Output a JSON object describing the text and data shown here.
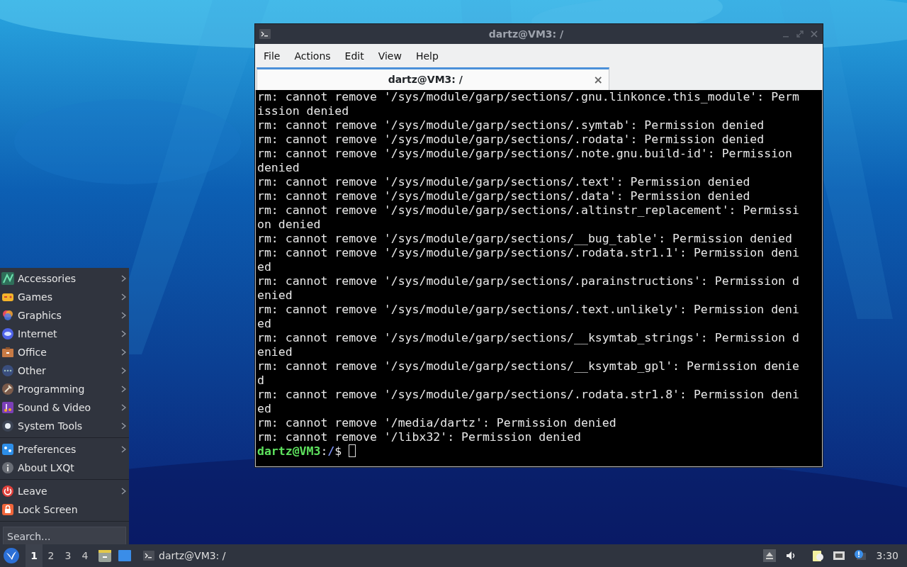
{
  "window": {
    "title": "dartz@VM3: /",
    "menu": [
      "File",
      "Actions",
      "Edit",
      "View",
      "Help"
    ],
    "tabs": [
      {
        "label": "dartz@VM3: /",
        "selected": true,
        "close": "×"
      }
    ],
    "terminal": {
      "lines": [
        "rm: cannot remove '/sys/module/garp/sections/.gnu.linkonce.this_module': Perm",
        "ission denied",
        "rm: cannot remove '/sys/module/garp/sections/.symtab': Permission denied",
        "rm: cannot remove '/sys/module/garp/sections/.rodata': Permission denied",
        "rm: cannot remove '/sys/module/garp/sections/.note.gnu.build-id': Permission",
        "denied",
        "rm: cannot remove '/sys/module/garp/sections/.text': Permission denied",
        "rm: cannot remove '/sys/module/garp/sections/.data': Permission denied",
        "rm: cannot remove '/sys/module/garp/sections/.altinstr_replacement': Permissi",
        "on denied",
        "rm: cannot remove '/sys/module/garp/sections/__bug_table': Permission denied",
        "rm: cannot remove '/sys/module/garp/sections/.rodata.str1.1': Permission deni",
        "ed",
        "rm: cannot remove '/sys/module/garp/sections/.parainstructions': Permission d",
        "enied",
        "rm: cannot remove '/sys/module/garp/sections/.text.unlikely': Permission deni",
        "ed",
        "rm: cannot remove '/sys/module/garp/sections/__ksymtab_strings': Permission d",
        "enied",
        "rm: cannot remove '/sys/module/garp/sections/__ksymtab_gpl': Permission denie",
        "d",
        "rm: cannot remove '/sys/module/garp/sections/.rodata.str1.8': Permission deni",
        "ed",
        "rm: cannot remove '/media/dartz': Permission denied",
        "rm: cannot remove '/libx32': Permission denied"
      ],
      "prompt": {
        "user_host": "dartz@VM3",
        "separator": ":",
        "path": "/",
        "symbol": "$"
      }
    }
  },
  "start_menu": {
    "sections": [
      [
        {
          "label": "Accessories",
          "submenu": true
        },
        {
          "label": "Games",
          "submenu": true
        },
        {
          "label": "Graphics",
          "submenu": true
        },
        {
          "label": "Internet",
          "submenu": true
        },
        {
          "label": "Office",
          "submenu": true
        },
        {
          "label": "Other",
          "submenu": true
        },
        {
          "label": "Programming",
          "submenu": true
        },
        {
          "label": "Sound & Video",
          "submenu": true
        },
        {
          "label": "System Tools",
          "submenu": true
        }
      ],
      [
        {
          "label": "Preferences",
          "submenu": true
        },
        {
          "label": "About LXQt",
          "submenu": false
        }
      ],
      [
        {
          "label": "Leave",
          "submenu": true
        },
        {
          "label": "Lock Screen",
          "submenu": false
        }
      ]
    ],
    "search": {
      "placeholder": "Search..."
    }
  },
  "taskbar": {
    "workspaces": [
      {
        "label": "1",
        "selected": true
      },
      {
        "label": "2",
        "selected": false
      },
      {
        "label": "3",
        "selected": false
      },
      {
        "label": "4",
        "selected": false
      }
    ],
    "tasks": [
      {
        "label": "dartz@VM3: /",
        "selected": false
      }
    ],
    "clock": "3:30"
  }
}
